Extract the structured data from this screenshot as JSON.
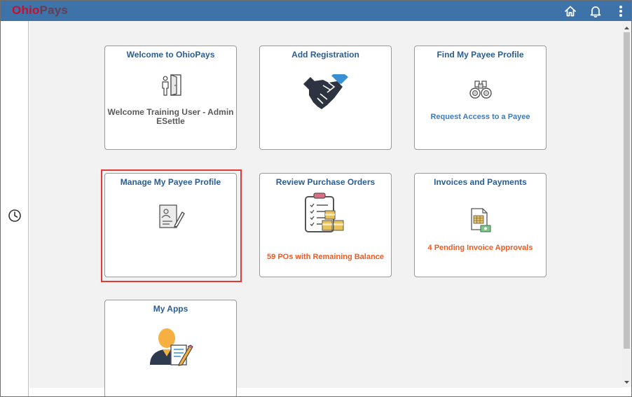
{
  "app": {
    "brand_letter_o": "O",
    "brand_ohio_rest": "hio",
    "brand_pays": "Pays"
  },
  "header": {
    "icons": [
      "home-icon",
      "bell-icon",
      "kebab-menu-icon"
    ]
  },
  "leftrail": {
    "icons": [
      "history-icon"
    ]
  },
  "tiles": [
    {
      "title": "Welcome to OhioPays",
      "subtitle_line1": "Welcome Training User - Admin",
      "subtitle_line2": "ESettle",
      "icon": "person-door-icon"
    },
    {
      "title": "Add Registration",
      "icon": "handshake-icon"
    },
    {
      "title": "Find My Payee Profile",
      "subtitle": "Request Access to a Payee",
      "icon": "binoculars-icon"
    },
    {
      "title": "Manage My Payee Profile",
      "icon": "profile-document-icon",
      "highlighted": true
    },
    {
      "title": "Review Purchase Orders",
      "subtitle": "59 POs with Remaining Balance",
      "icon": "clipboard-boxes-icon"
    },
    {
      "title": "Invoices and Payments",
      "subtitle": "4 Pending Invoice Approvals",
      "icon": "invoice-money-icon"
    },
    {
      "title": "My Apps",
      "icon": "user-form-icon"
    }
  ],
  "colors": {
    "header_bg": "#3d73a9",
    "tile_title": "#2a5d94",
    "highlight_border": "#e53935",
    "alert_text": "#ef5b25",
    "link_text": "#3b7bbf"
  }
}
